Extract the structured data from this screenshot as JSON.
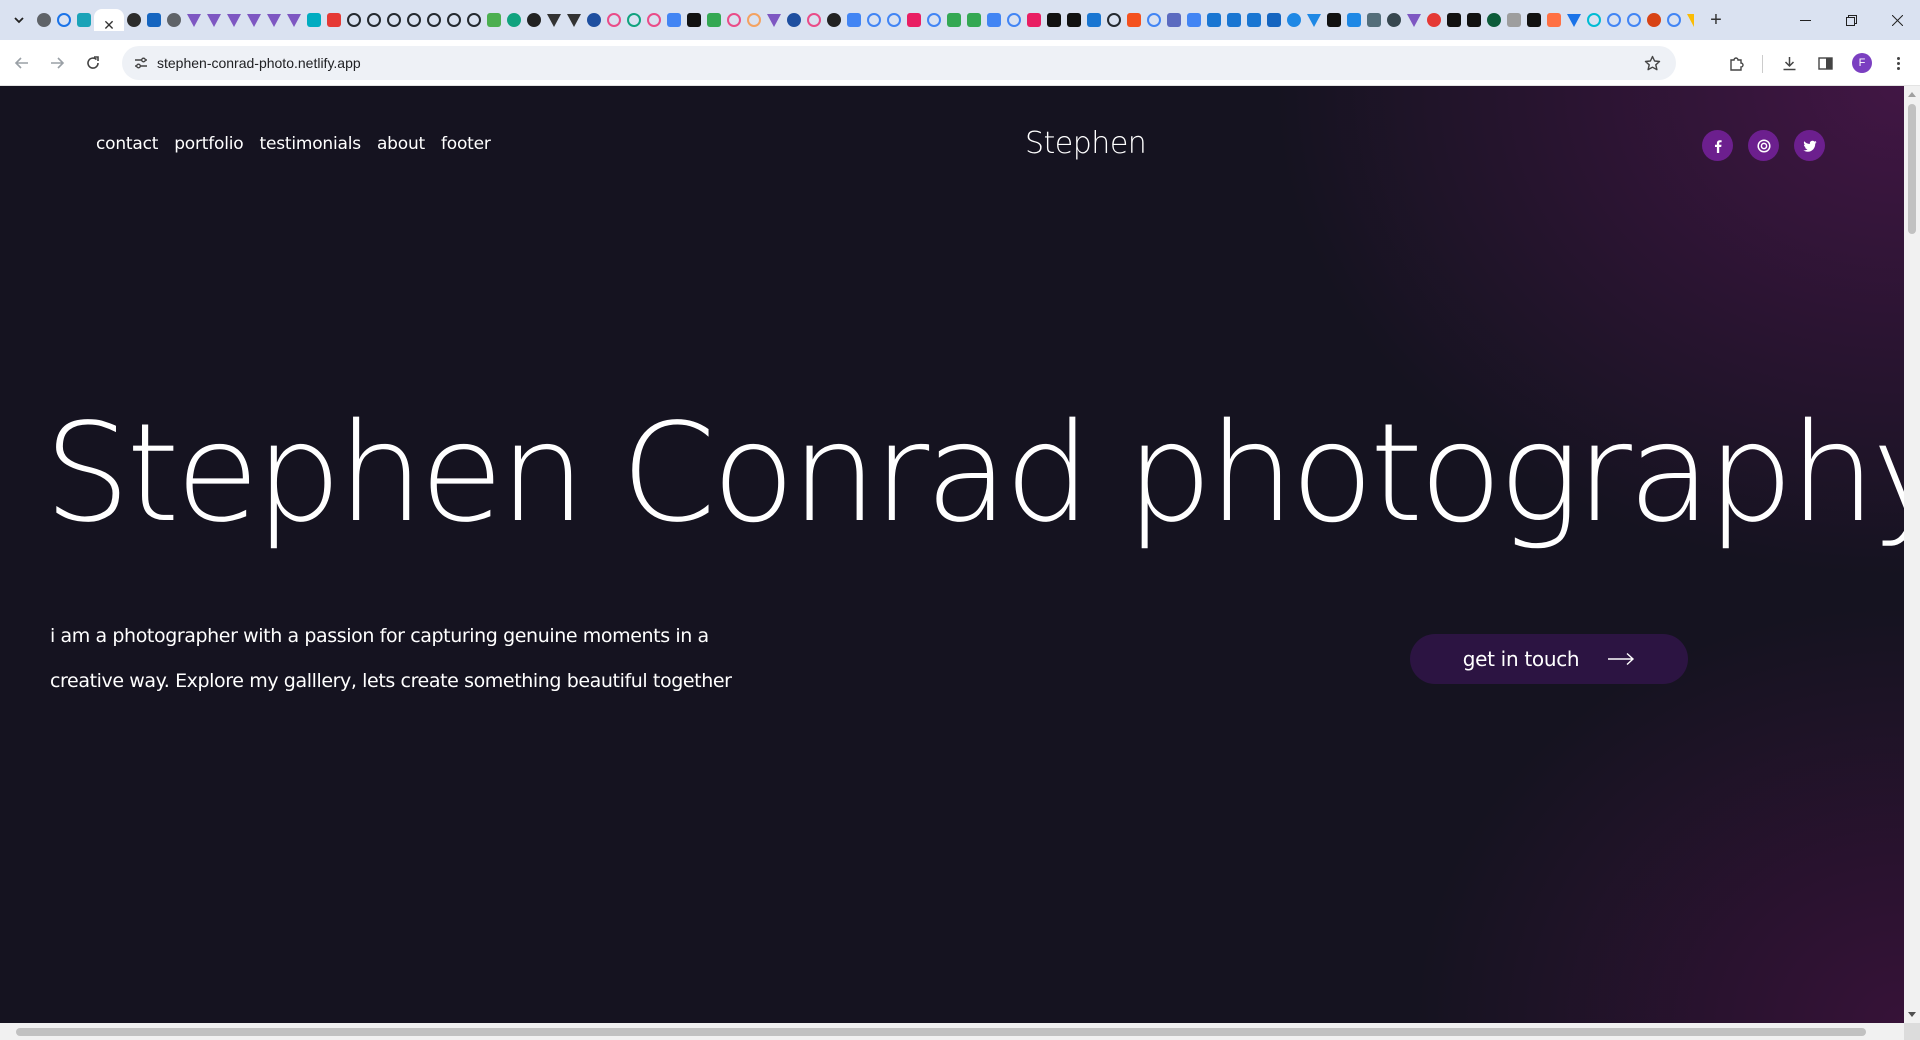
{
  "browser": {
    "url": "stephen-conrad-photo.netlify.app",
    "active_tab_close": "✕",
    "new_tab": "+",
    "profile_initial": "F",
    "tab_favicons": [
      {
        "color": "#5f6368",
        "shape": "circle"
      },
      {
        "color": "#1a73e8",
        "shape": "ring"
      },
      {
        "color": "#1aa3b8",
        "shape": "sq"
      },
      {
        "color": "#2c2c2c",
        "shape": "circle"
      },
      {
        "color": "#1565c0",
        "shape": "sq"
      },
      {
        "color": "#5f6368",
        "shape": "circle"
      },
      {
        "color": "#7e57c2",
        "shape": "tri"
      },
      {
        "color": "#7e57c2",
        "shape": "tri"
      },
      {
        "color": "#7e57c2",
        "shape": "tri"
      },
      {
        "color": "#7e57c2",
        "shape": "tri"
      },
      {
        "color": "#7e57c2",
        "shape": "tri"
      },
      {
        "color": "#7e57c2",
        "shape": "tri"
      },
      {
        "color": "#00acc1",
        "shape": "sq"
      },
      {
        "color": "#e53935",
        "shape": "sq"
      },
      {
        "color": "#24292f",
        "shape": "ring"
      },
      {
        "color": "#24292f",
        "shape": "ring"
      },
      {
        "color": "#24292f",
        "shape": "ring"
      },
      {
        "color": "#24292f",
        "shape": "ring"
      },
      {
        "color": "#24292f",
        "shape": "ring"
      },
      {
        "color": "#24292f",
        "shape": "ring"
      },
      {
        "color": "#24292f",
        "shape": "ring"
      },
      {
        "color": "#4caf50",
        "shape": "sq"
      },
      {
        "color": "#10a37f",
        "shape": "circle"
      },
      {
        "color": "#222222",
        "shape": "circle"
      },
      {
        "color": "#333333",
        "shape": "tri"
      },
      {
        "color": "#333333",
        "shape": "tri"
      },
      {
        "color": "#1e4fa0",
        "shape": "circle"
      },
      {
        "color": "#ea4c89",
        "shape": "ring"
      },
      {
        "color": "#10a37f",
        "shape": "ring"
      },
      {
        "color": "#ea4c89",
        "shape": "ring"
      },
      {
        "color": "#4285f4",
        "shape": "sq"
      },
      {
        "color": "#111111",
        "shape": "sq"
      },
      {
        "color": "#34a853",
        "shape": "sq"
      },
      {
        "color": "#ea4c89",
        "shape": "ring"
      },
      {
        "color": "#f4a261",
        "shape": "ring"
      },
      {
        "color": "#7e57c2",
        "shape": "tri"
      },
      {
        "color": "#1e4fa0",
        "shape": "circle"
      },
      {
        "color": "#ea4c89",
        "shape": "ring"
      },
      {
        "color": "#222222",
        "shape": "circle"
      },
      {
        "color": "#4285f4",
        "shape": "sq"
      },
      {
        "color": "#4285f4",
        "shape": "ring"
      },
      {
        "color": "#4285f4",
        "shape": "ring"
      },
      {
        "color": "#e91e63",
        "shape": "sq"
      },
      {
        "color": "#4285f4",
        "shape": "ring"
      },
      {
        "color": "#34a853",
        "shape": "sq"
      },
      {
        "color": "#34a853",
        "shape": "sq"
      },
      {
        "color": "#4285f4",
        "shape": "sq"
      },
      {
        "color": "#4285f4",
        "shape": "ring"
      },
      {
        "color": "#e91e63",
        "shape": "sq"
      },
      {
        "color": "#111111",
        "shape": "sq"
      },
      {
        "color": "#111111",
        "shape": "sq"
      },
      {
        "color": "#1976d2",
        "shape": "sq"
      },
      {
        "color": "#24292f",
        "shape": "ring"
      },
      {
        "color": "#f4511e",
        "shape": "sq"
      },
      {
        "color": "#4285f4",
        "shape": "ring"
      },
      {
        "color": "#5c6bc0",
        "shape": "sq"
      },
      {
        "color": "#4285f4",
        "shape": "sq"
      },
      {
        "color": "#1976d2",
        "shape": "sq"
      },
      {
        "color": "#1976d2",
        "shape": "sq"
      },
      {
        "color": "#1976d2",
        "shape": "sq"
      },
      {
        "color": "#1565c0",
        "shape": "sq"
      },
      {
        "color": "#1e88e5",
        "shape": "circle"
      },
      {
        "color": "#1e88e5",
        "shape": "tri"
      },
      {
        "color": "#111111",
        "shape": "sq"
      },
      {
        "color": "#1e88e5",
        "shape": "sq"
      },
      {
        "color": "#546e7a",
        "shape": "sq"
      },
      {
        "color": "#37474f",
        "shape": "circle"
      },
      {
        "color": "#7e57c2",
        "shape": "tri"
      },
      {
        "color": "#e53935",
        "shape": "circle"
      },
      {
        "color": "#111111",
        "shape": "sq"
      },
      {
        "color": "#111111",
        "shape": "sq"
      },
      {
        "color": "#0d5c3a",
        "shape": "circle"
      },
      {
        "color": "#9e9e9e",
        "shape": "sq"
      },
      {
        "color": "#111111",
        "shape": "sq"
      },
      {
        "color": "#ff7043",
        "shape": "sq"
      },
      {
        "color": "#1a73e8",
        "shape": "tri"
      },
      {
        "color": "#00bcd4",
        "shape": "ring"
      },
      {
        "color": "#4285f4",
        "shape": "ring"
      },
      {
        "color": "#4285f4",
        "shape": "ring"
      },
      {
        "color": "#d84315",
        "shape": "circle"
      },
      {
        "color": "#4285f4",
        "shape": "ring"
      },
      {
        "color": "#fbbc04",
        "shape": "tri"
      },
      {
        "color": "#fbbc04",
        "shape": "tri"
      },
      {
        "color": "#34a853",
        "shape": "sq"
      },
      {
        "color": "#26a69a",
        "shape": "tri"
      },
      {
        "color": "#5f6368",
        "shape": "ring"
      }
    ]
  },
  "site": {
    "nav": [
      "contact",
      "portfolio",
      "testimonials",
      "about",
      "footer"
    ],
    "brand": "Stephen",
    "socials": [
      {
        "name": "facebook-icon",
        "glyph": "f"
      },
      {
        "name": "dribbble-icon",
        "glyph": "◎"
      },
      {
        "name": "twitter-icon",
        "glyph": "t"
      }
    ],
    "hero_title": "Stephen Conrad photography",
    "hero_text": "i am a photographer with a passion for capturing genuine moments in a creative way. Explore my galllery, lets create something beautiful together",
    "cta_label": "get in touch",
    "colors": {
      "background": "#151320",
      "accent": "#6c1f8e",
      "cta_bg": "#2c1442"
    }
  }
}
